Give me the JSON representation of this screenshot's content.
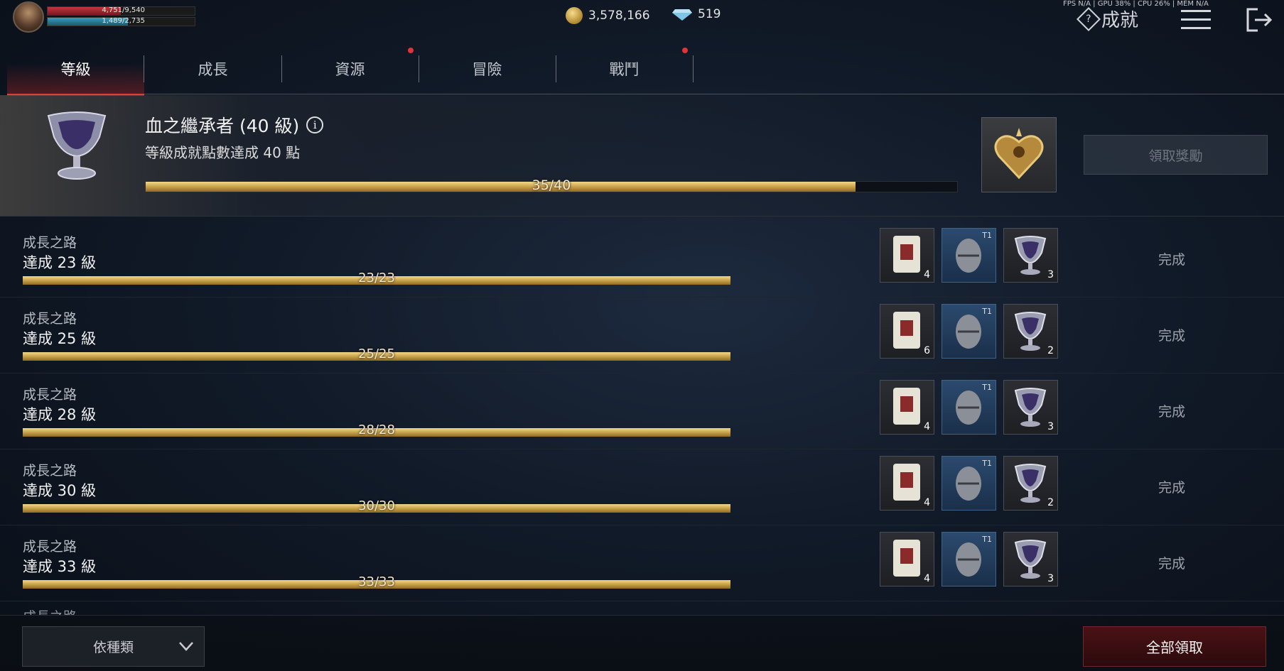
{
  "player": {
    "hp_text": "4,751/9,540",
    "hp_ratio": 0.498,
    "mp_text": "1,489/2,735",
    "mp_ratio": 0.544
  },
  "currency": {
    "gold": "3,578,166",
    "gems": "519"
  },
  "perf": "FPS N/A | GPU 38% | CPU 26% | MEM N/A",
  "page_title": "成就",
  "tabs": [
    {
      "label": "等級",
      "active": true,
      "badge": false
    },
    {
      "label": "成長",
      "active": false,
      "badge": false
    },
    {
      "label": "資源",
      "active": false,
      "badge": true
    },
    {
      "label": "冒險",
      "active": false,
      "badge": false
    },
    {
      "label": "戰鬥",
      "active": false,
      "badge": true
    }
  ],
  "header": {
    "title": "血之繼承者 (40 級)",
    "subtitle": "等級成就點數達成 40 點",
    "progress_text": "35/40",
    "progress_ratio": 0.875,
    "claim_label": "領取獎勵"
  },
  "rows": [
    {
      "category": "成長之路",
      "title": "達成 23 級",
      "progress_text": "23/23",
      "items": [
        {
          "qty": "4"
        },
        {
          "tier": "T1"
        },
        {
          "qty": "3"
        }
      ],
      "status": "完成"
    },
    {
      "category": "成長之路",
      "title": "達成 25 級",
      "progress_text": "25/25",
      "items": [
        {
          "qty": "6"
        },
        {
          "tier": "T1"
        },
        {
          "qty": "2"
        }
      ],
      "status": "完成"
    },
    {
      "category": "成長之路",
      "title": "達成 28 級",
      "progress_text": "28/28",
      "items": [
        {
          "qty": "4"
        },
        {
          "tier": "T1"
        },
        {
          "qty": "3"
        }
      ],
      "status": "完成"
    },
    {
      "category": "成長之路",
      "title": "達成 30 級",
      "progress_text": "30/30",
      "items": [
        {
          "qty": "4"
        },
        {
          "tier": "T1"
        },
        {
          "qty": "2"
        }
      ],
      "status": "完成"
    },
    {
      "category": "成長之路",
      "title": "達成 33 級",
      "progress_text": "33/33",
      "items": [
        {
          "qty": "4"
        },
        {
          "tier": "T1"
        },
        {
          "qty": "3"
        }
      ],
      "status": "完成"
    }
  ],
  "partial_row_category": "成長之路",
  "footer": {
    "sort_label": "依種類",
    "claim_all_label": "全部領取"
  },
  "colors": {
    "accent_red": "#d8423a",
    "gold_bar": "#c9a24a",
    "badge_red": "#e0333a"
  }
}
